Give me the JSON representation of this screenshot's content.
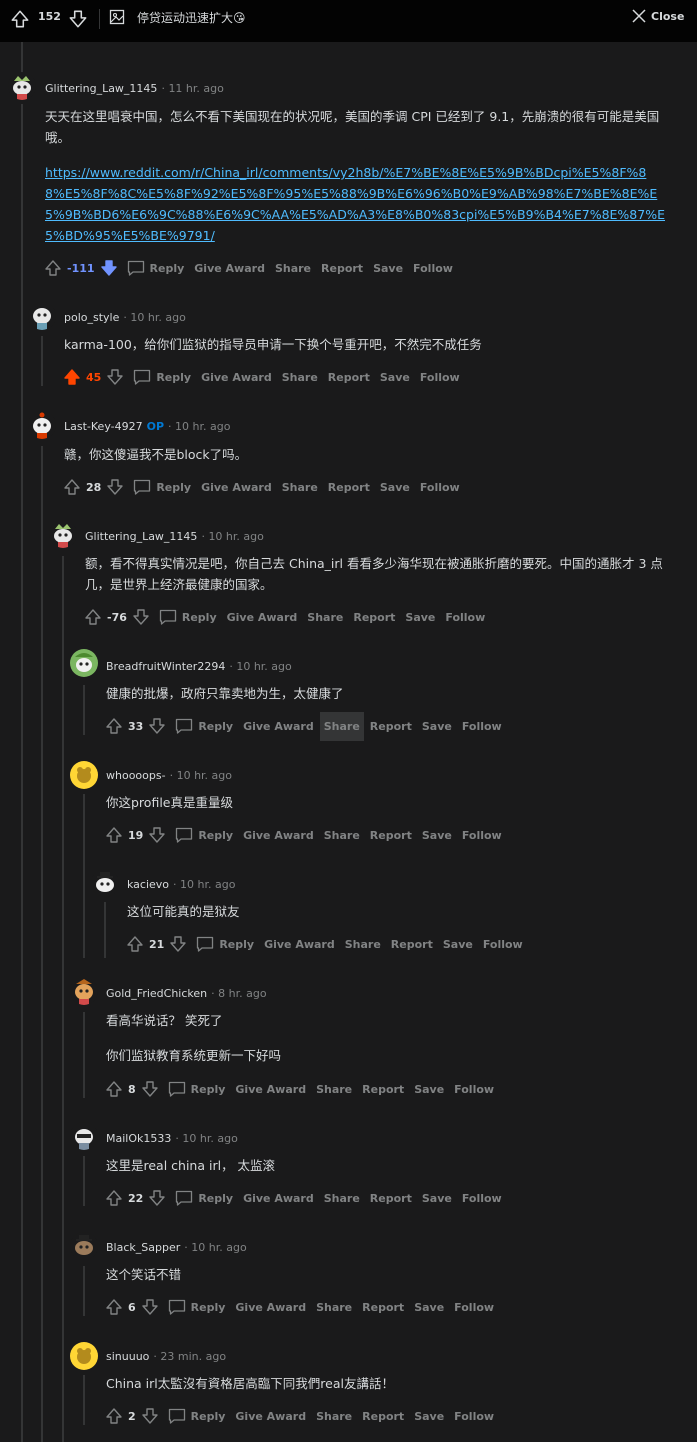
{
  "topbar": {
    "score": "152",
    "title": "停贷运动迅速扩大😘",
    "close_label": "Close"
  },
  "labels": {
    "reply": "Reply",
    "give_award": "Give Award",
    "share": "Share",
    "report": "Report",
    "save": "Save",
    "follow": "Follow",
    "op": "OP"
  },
  "comments": [
    {
      "user": "Glittering_Law_1145",
      "time": "11 hr. ago",
      "text": "天天在这里唱衰中国，怎么不看下美国现在的状况呢，美国的季调 CPI 已经到了 9.1，先崩溃的很有可能是美国哦。",
      "link": "https://www.reddit.com/r/China_irl/comments/vy2h8b/%E7%BE%8E%E5%9B%BDcpi%E5%8F%88%E5%8F%8C%E5%8F%92%E5%8F%95%E5%88%9B%E6%96%B0%E9%AB%98%E7%BE%8E%E5%9B%BD6%E6%9C%88%E6%9C%AA%E5%AD%A3%E8%B0%83cpi%E5%B9%B4%E7%8E%87%E5%BD%95%E5%BE%9791/",
      "score": "-111",
      "vote": "down"
    },
    {
      "user": "polo_style",
      "time": "10 hr. ago",
      "text": "karma-100，给你们监狱的指导员申请一下换个号重开吧，不然完不成任务",
      "score": "45",
      "vote": "up"
    },
    {
      "user": "Last-Key-4927",
      "time": "10 hr. ago",
      "op": true,
      "text": "赣，你这傻逼我不是block了吗。",
      "score": "28"
    },
    {
      "user": "Glittering_Law_1145",
      "time": "10 hr. ago",
      "text": "额，看不得真实情况是吧，你自己去 China_irl 看看多少海华现在被通胀折磨的要死。中国的通胀才 3 点几，是世界上经济最健康的国家。",
      "score": "-76"
    },
    {
      "user": "BreadfruitWinter2294",
      "time": "10 hr. ago",
      "text": "健康的批爆，政府只靠卖地为生，太健康了",
      "score": "33"
    },
    {
      "user": "whoooops-",
      "time": "10 hr. ago",
      "text": "你这profile真是重量级",
      "score": "19"
    },
    {
      "user": "kacievo",
      "time": "10 hr. ago",
      "text": "这位可能真的是狱友",
      "score": "21"
    },
    {
      "user": "Gold_FriedChicken",
      "time": "8 hr. ago",
      "text": "看高华说话？ 笑死了",
      "text2": "你们监狱教育系统更新一下好吗",
      "score": "8"
    },
    {
      "user": "MailOk1533",
      "time": "10 hr. ago",
      "text": "这里是real china irl， 太监滚",
      "score": "22"
    },
    {
      "user": "Black_Sapper",
      "time": "10 hr. ago",
      "text": "这个笑话不错",
      "score": "6"
    },
    {
      "user": "sinuuuo",
      "time": "23 min. ago",
      "text": "China irl太監沒有資格居高臨下同我們real友講話！",
      "score": "2"
    }
  ]
}
